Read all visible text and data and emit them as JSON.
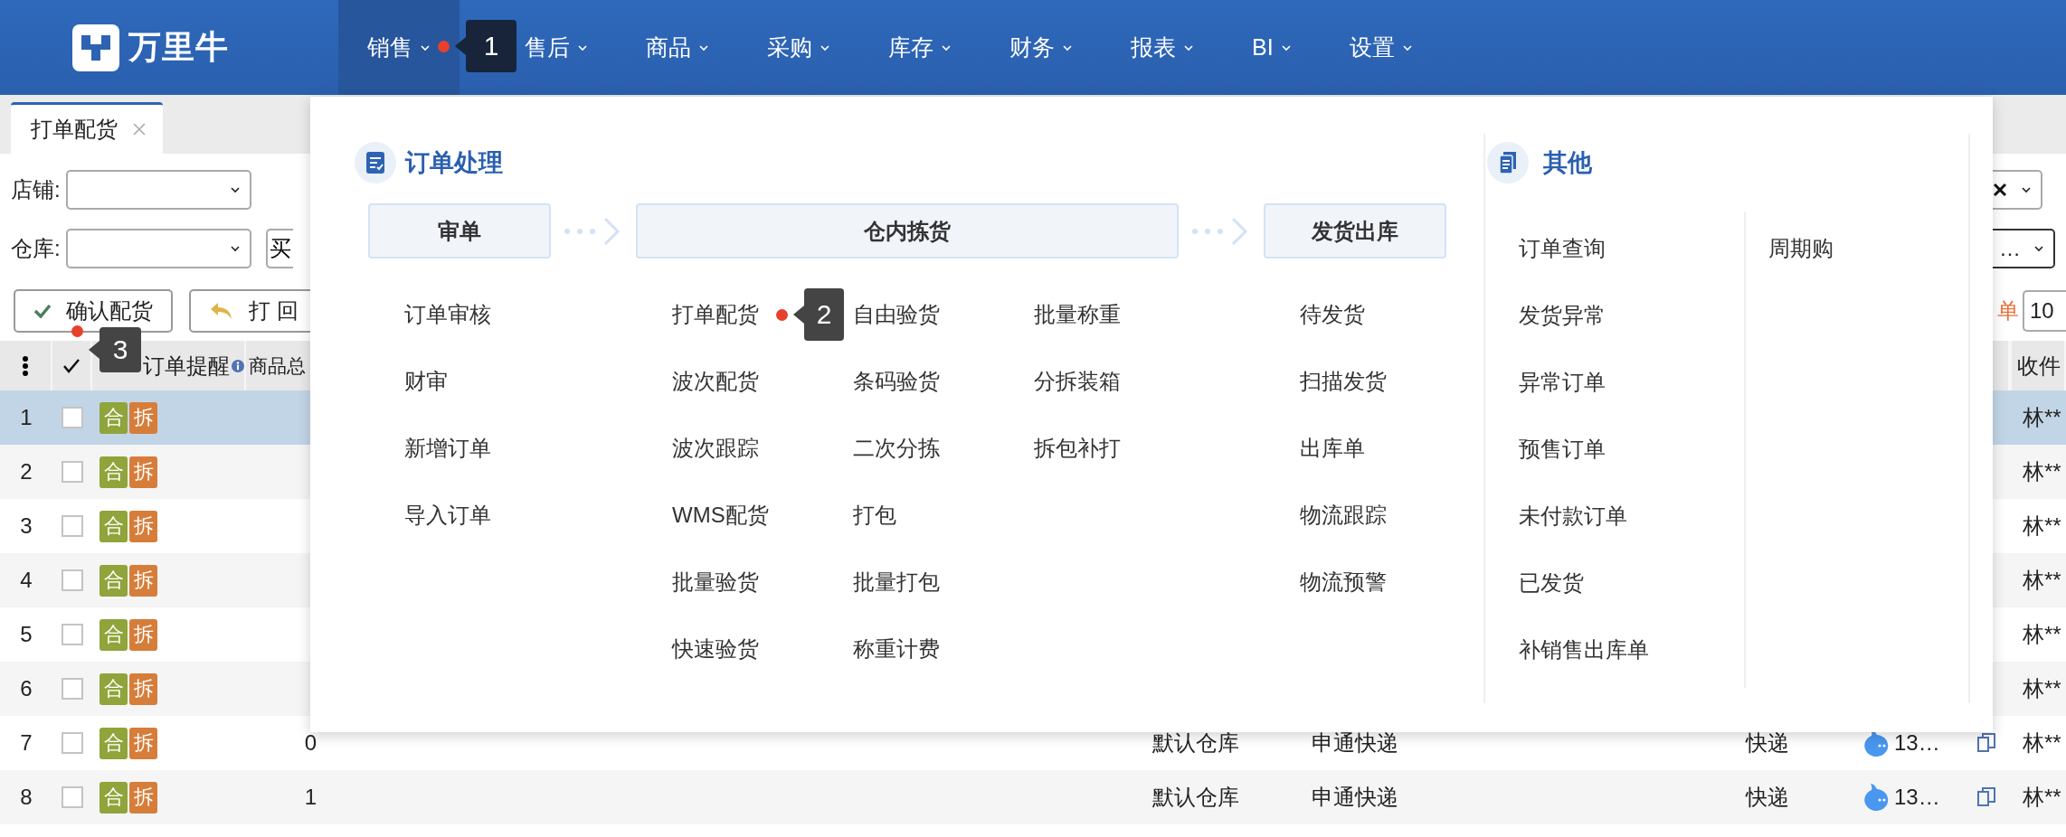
{
  "logo": "万里牛",
  "nav": [
    {
      "label": "销售",
      "selected": true,
      "marker": "1"
    },
    {
      "label": "售后",
      "selected": false
    },
    {
      "label": "商品",
      "selected": false
    },
    {
      "label": "采购",
      "selected": false
    },
    {
      "label": "库存",
      "selected": false
    },
    {
      "label": "财务",
      "selected": false
    },
    {
      "label": "报表",
      "selected": false
    },
    {
      "label": "BI",
      "selected": false
    },
    {
      "label": "设置",
      "selected": false
    }
  ],
  "tabs": [
    {
      "label": "打单配货",
      "selected": true
    }
  ],
  "filters": [
    {
      "label": "店铺:",
      "right_field": {
        "clear": true
      }
    },
    {
      "label": "仓库:",
      "button": "买",
      "right_field": {
        "value": "…"
      }
    }
  ],
  "toolbar": {
    "buttons": [
      {
        "label": "确认配货",
        "kind": "confirm",
        "marker": "3"
      },
      {
        "label": "打 回",
        "kind": "return"
      }
    ],
    "link": "单",
    "page_size": "10"
  },
  "table": {
    "header": {
      "reminder": "订单提醒",
      "quantity": "商品总",
      "receiver": "收件"
    },
    "rows": [
      {
        "index": "1",
        "selected": true,
        "checked": false,
        "tags": [
          {
            "label": "合",
            "color": "#8fa43a"
          },
          {
            "label": "拆",
            "color": "#d67d3a"
          }
        ],
        "receiver": "林**"
      },
      {
        "index": "2",
        "selected": false,
        "checked": false,
        "tags": [
          {
            "label": "合",
            "color": "#8fa43a"
          },
          {
            "label": "拆",
            "color": "#d67d3a"
          }
        ],
        "receiver": "林**"
      },
      {
        "index": "3",
        "selected": false,
        "checked": false,
        "tags": [
          {
            "label": "合",
            "color": "#8fa43a"
          },
          {
            "label": "拆",
            "color": "#d67d3a"
          }
        ],
        "receiver": "林**"
      },
      {
        "index": "4",
        "selected": false,
        "checked": false,
        "tags": [
          {
            "label": "合",
            "color": "#8fa43a"
          },
          {
            "label": "拆",
            "color": "#d67d3a"
          }
        ],
        "receiver": "林**"
      },
      {
        "index": "5",
        "selected": false,
        "checked": false,
        "tags": [
          {
            "label": "合",
            "color": "#8fa43a"
          },
          {
            "label": "拆",
            "color": "#d67d3a"
          }
        ],
        "receiver": "林**"
      },
      {
        "index": "6",
        "selected": false,
        "checked": false,
        "tags": [
          {
            "label": "合",
            "color": "#8fa43a"
          },
          {
            "label": "拆",
            "color": "#d67d3a"
          }
        ],
        "receiver": "林**"
      },
      {
        "index": "7",
        "selected": false,
        "checked": false,
        "tags": [
          {
            "label": "合",
            "color": "#8fa43a"
          },
          {
            "label": "拆",
            "color": "#d67d3a"
          }
        ],
        "quantity": "0",
        "warehouse": "默认仓库",
        "carrier": "申通快递",
        "type": "快递",
        "phone": "13…",
        "receiver": "林**"
      },
      {
        "index": "8",
        "selected": false,
        "checked": false,
        "tags": [
          {
            "label": "合",
            "color": "#8fa43a"
          },
          {
            "label": "拆",
            "color": "#d67d3a"
          }
        ],
        "quantity": "1",
        "warehouse": "默认仓库",
        "carrier": "申通快递",
        "type": "快递",
        "phone": "13…",
        "receiver": "林**"
      }
    ]
  },
  "menu": {
    "flow": {
      "title": "订单处理",
      "stages": [
        {
          "title": "审单",
          "columns": [
            [
              {
                "label": "订单审核"
              },
              {
                "label": "财审"
              },
              {
                "label": "新增订单"
              },
              {
                "label": "导入订单"
              }
            ]
          ]
        },
        {
          "title": "仓内拣货",
          "columns": [
            [
              {
                "label": "打单配货",
                "marker": "2"
              },
              {
                "label": "波次配货"
              },
              {
                "label": "波次跟踪"
              },
              {
                "label": "WMS配货"
              },
              {
                "label": "批量验货"
              },
              {
                "label": "快速验货"
              }
            ],
            [
              {
                "label": "自由验货"
              },
              {
                "label": "条码验货"
              },
              {
                "label": "二次分拣"
              },
              {
                "label": "打包"
              },
              {
                "label": "批量打包"
              },
              {
                "label": "称重计费"
              }
            ],
            [
              {
                "label": "批量称重"
              },
              {
                "label": "分拆装箱"
              },
              {
                "label": "拆包补打"
              }
            ]
          ]
        },
        {
          "title": "发货出库",
          "columns": [
            [
              {
                "label": "待发货"
              },
              {
                "label": "扫描发货"
              },
              {
                "label": "出库单"
              },
              {
                "label": "物流跟踪"
              },
              {
                "label": "物流预警"
              }
            ]
          ]
        }
      ]
    },
    "other": {
      "title": "其他",
      "columns": [
        [
          {
            "label": "订单查询"
          },
          {
            "label": "发货异常"
          },
          {
            "label": "异常订单"
          },
          {
            "label": "预售订单"
          },
          {
            "label": "未付款订单"
          },
          {
            "label": "已发货"
          },
          {
            "label": "补销售出库单"
          }
        ],
        [
          {
            "label": "周期购"
          }
        ]
      ]
    }
  }
}
